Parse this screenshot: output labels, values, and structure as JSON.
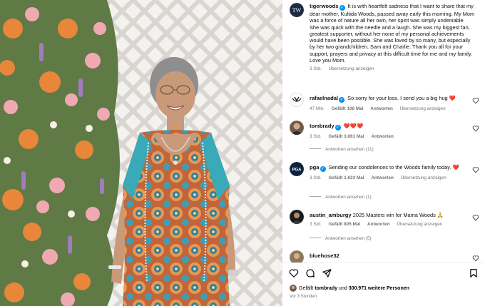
{
  "post": {
    "username": "tigerwoods",
    "caption": "It is with heartfelt sadness that I want to share that my dear mother, Kultida Woods, passed away early this morning. My Mom was a force of nature all her own, her spirit was simply undeniable. She was quick with the needle and a laugh. She was my biggest fan, greatest supporter, without her none of my personal achievements would have been possible. She was loved by so many, but especially by her two grandchildren, Sam and Charlie. Thank you all for your support, prayers and privacy at this difficult time for me and my family. Love you Mom.",
    "time": "3 Std.",
    "translate": "Übersetzung anzeigen"
  },
  "comments": [
    {
      "username": "rafaelnadal",
      "verified": true,
      "text": "So sorry for your loss. I send you a big hug",
      "emoji": "❤️",
      "time": "47 Min.",
      "likes": "Gefällt 106 Mal",
      "reply": "Antworten",
      "translate": "Übersetzung anzeigen",
      "view_replies": ""
    },
    {
      "username": "tombrady",
      "verified": true,
      "text": "",
      "emoji": "❤️❤️❤️",
      "time": "3 Std.",
      "likes": "Gefällt 3.061 Mal",
      "reply": "Antworten",
      "translate": "",
      "view_replies": "Antworten ansehen (11)"
    },
    {
      "username": "pga",
      "verified": true,
      "text": "Sending our condolences to the Woods family today.",
      "emoji": "❤️",
      "time": "3 Std.",
      "likes": "Gefällt 1.633 Mal",
      "reply": "Antworten",
      "translate": "Übersetzung anzeigen",
      "view_replies": "Antworten ansehen (1)"
    },
    {
      "username": "austin_amburgy",
      "verified": false,
      "text": "2025 Masters win for Mama Woods",
      "emoji": "🙏",
      "time": "3 Std.",
      "likes": "Gefällt 805 Mal",
      "reply": "Antworten",
      "translate": "Übersetzung anzeigen",
      "view_replies": "Antworten ansehen (5)"
    },
    {
      "username": "bluehose32",
      "verified": false,
      "text": "",
      "emoji": "",
      "time": "",
      "likes": "",
      "reply": "",
      "translate": "",
      "view_replies": ""
    }
  ],
  "footer": {
    "liked_prefix": "Gefällt",
    "liked_user": "tombrady",
    "liked_middle": "und",
    "liked_count": "300.971 weitere Personen",
    "posted": "Vor 3 Stunden"
  },
  "colors": {
    "verified": "#0095f6",
    "heart": "#ed4956",
    "meta": "#737373"
  },
  "icons": {
    "like": "heart-outline-icon",
    "comment": "comment-icon",
    "share": "send-icon",
    "save": "bookmark-icon"
  }
}
